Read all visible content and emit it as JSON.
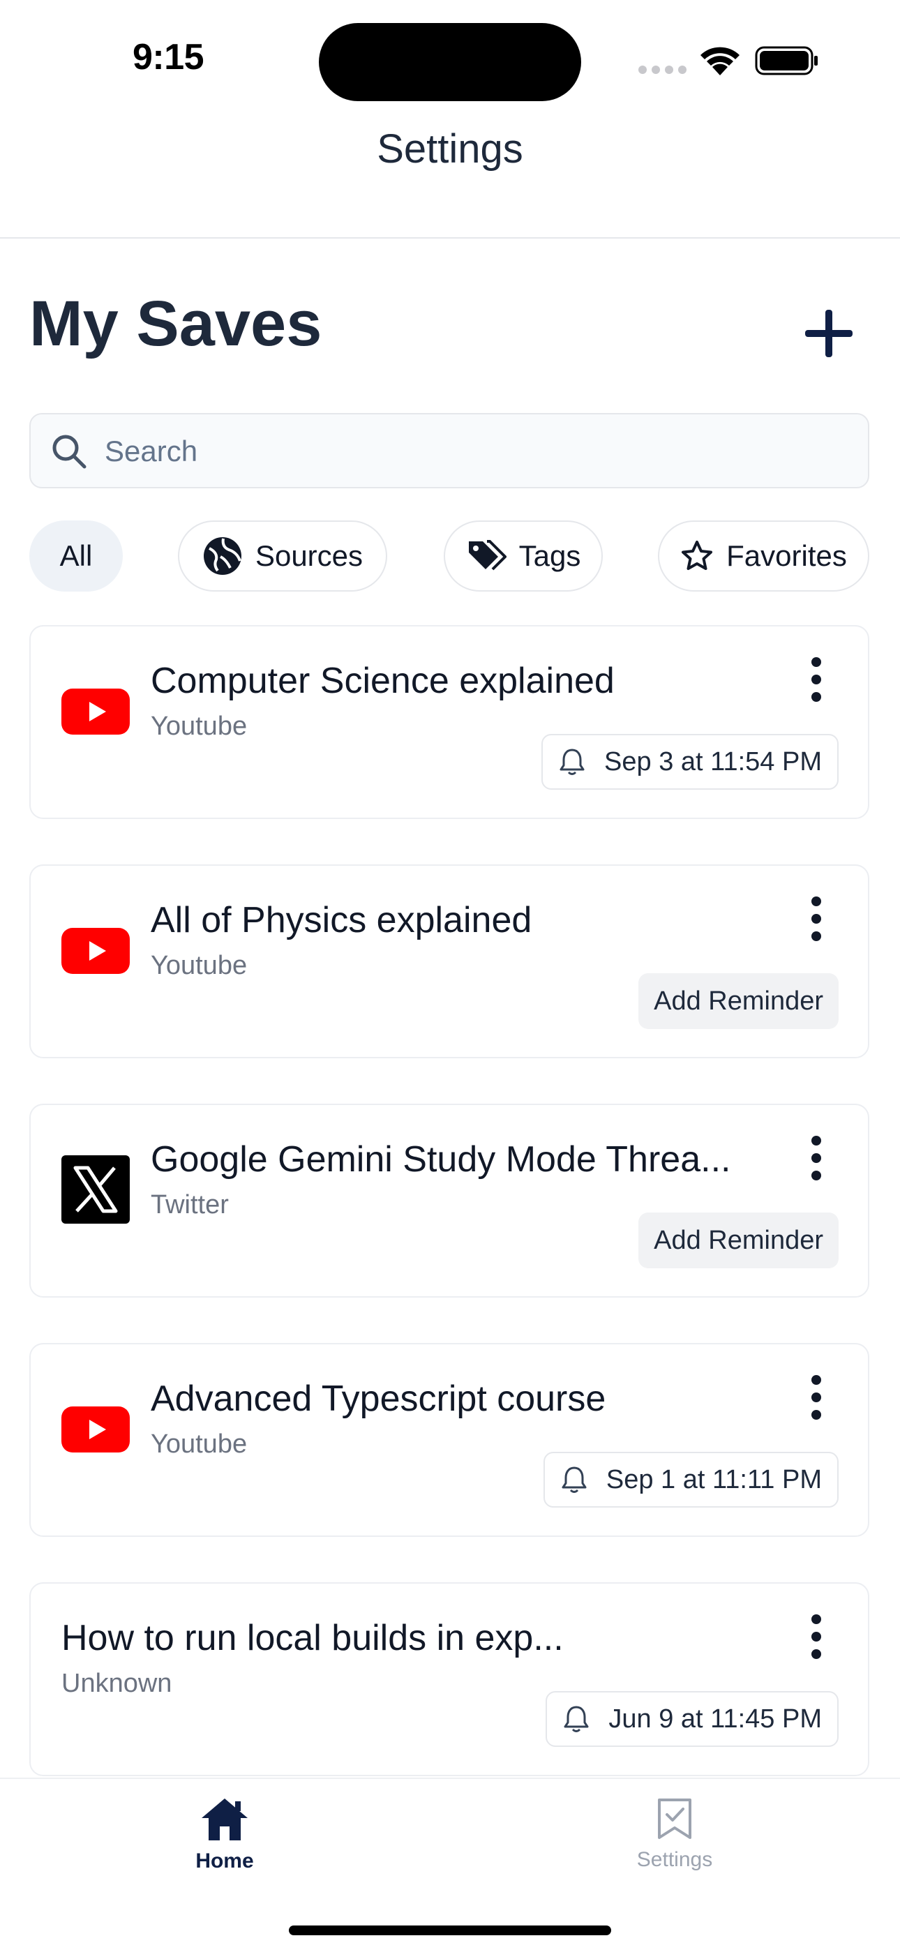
{
  "status_bar": {
    "time": "9:15"
  },
  "header": {
    "title": "Settings"
  },
  "page": {
    "title": "My Saves"
  },
  "search": {
    "placeholder": "Search"
  },
  "filters": [
    {
      "label": "All",
      "active": true
    },
    {
      "label": "Sources",
      "icon": "globe-icon"
    },
    {
      "label": "Tags",
      "icon": "tags-icon"
    },
    {
      "label": "Favorites",
      "icon": "star-icon"
    }
  ],
  "saves": [
    {
      "title": "Computer Science explained",
      "source": "Youtube",
      "icon": "youtube-icon",
      "reminder": "Sep 3 at 11:54 PM",
      "reminder_set": true
    },
    {
      "title": "All of Physics explained",
      "source": "Youtube",
      "icon": "youtube-icon",
      "reminder": "Add Reminder",
      "reminder_set": false
    },
    {
      "title": "Google Gemini Study Mode Threa...",
      "source": "Twitter",
      "icon": "x-logo-icon",
      "reminder": "Add Reminder",
      "reminder_set": false
    },
    {
      "title": "Advanced Typescript course",
      "source": "Youtube",
      "icon": "youtube-icon",
      "reminder": "Sep 1 at 11:11 PM",
      "reminder_set": true
    },
    {
      "title": "How to run local builds in exp...",
      "source": "Unknown",
      "icon": "none",
      "reminder": "Jun 9 at 11:45 PM",
      "reminder_set": true
    }
  ],
  "tab_bar": {
    "home": {
      "label": "Home",
      "active": true
    },
    "settings": {
      "label": "Settings",
      "active": false
    }
  },
  "colors": {
    "accent": "#0f1f45",
    "youtube_red": "#ff0000",
    "muted": "#6b7280",
    "tab_inactive": "#9ca3af"
  }
}
